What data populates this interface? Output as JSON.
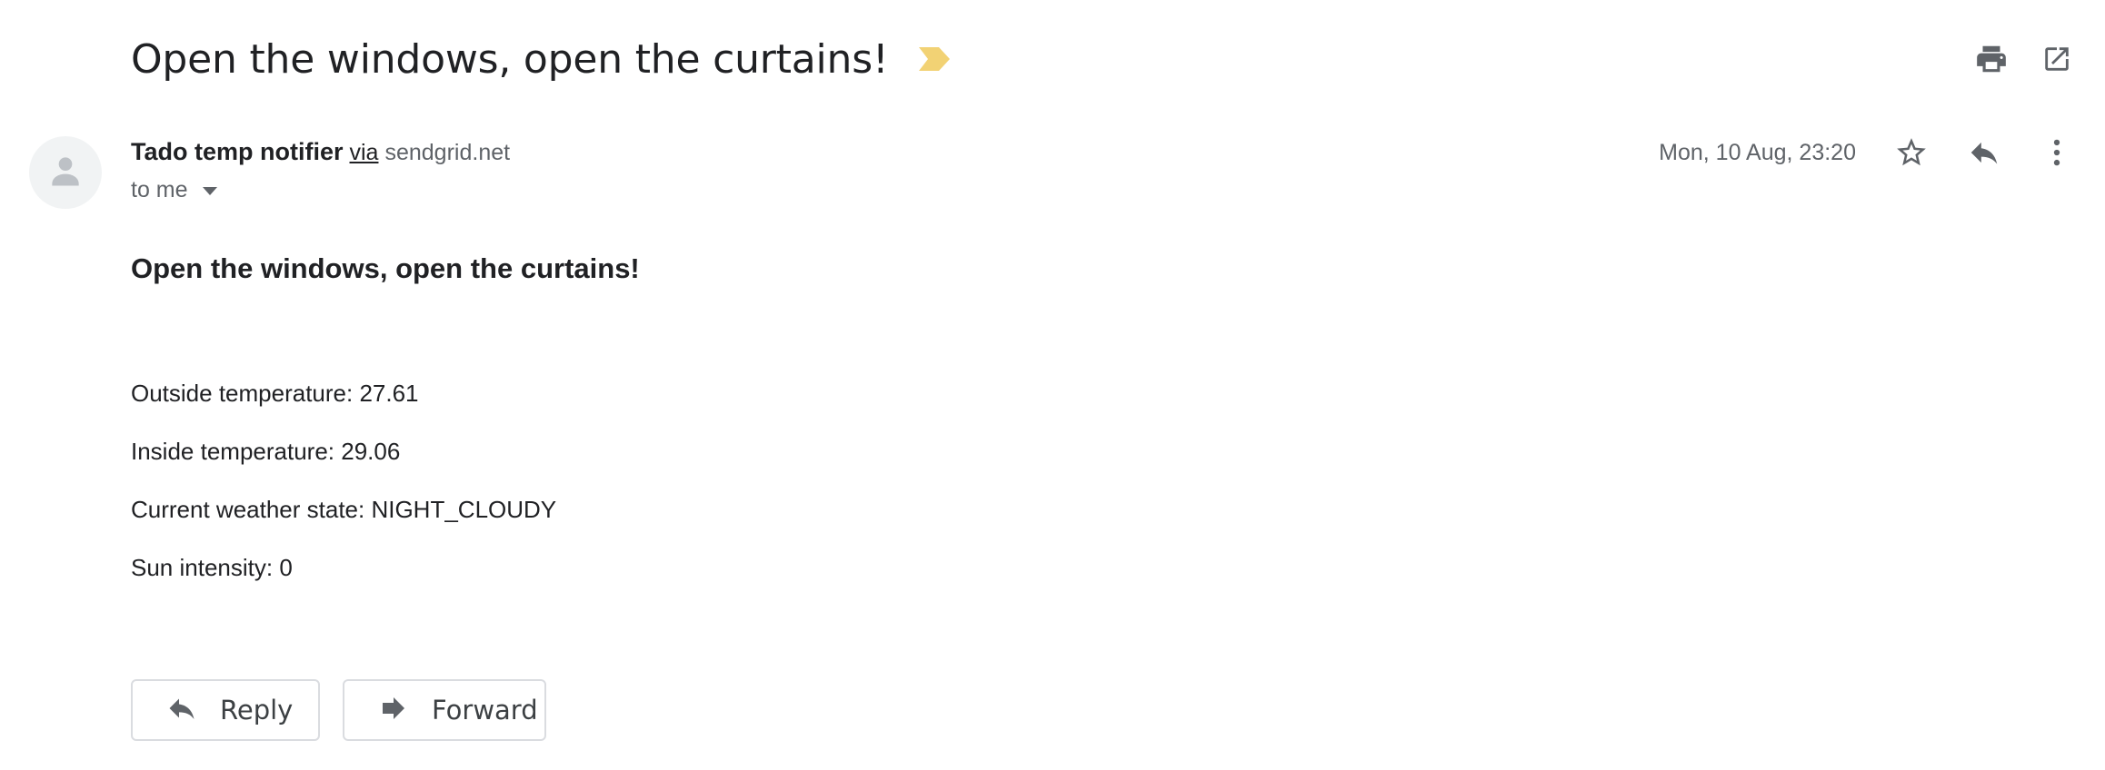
{
  "subject": {
    "title": "Open the windows, open the curtains!",
    "importance_icon": "importance-marker-icon",
    "importance_color": "#f2d274"
  },
  "toolbar": {
    "print_icon": "print-icon",
    "open_new_window_icon": "open-in-new-icon"
  },
  "message": {
    "sender_name": "Tado temp notifier",
    "via_label": "via",
    "via_domain": "sendgrid.net",
    "recipient": "to me",
    "timestamp": "Mon, 10 Aug, 23:20",
    "star_icon": "star-icon",
    "reply_icon": "reply-icon",
    "more_icon": "more-vert-icon"
  },
  "body": {
    "heading": "Open the windows, open the curtains!",
    "lines": [
      "Outside temperature: 27.61",
      "Inside temperature: 29.06",
      "Current weather state: NIGHT_CLOUDY",
      "Sun intensity: 0"
    ]
  },
  "actions": {
    "reply_label": "Reply",
    "forward_label": "Forward"
  },
  "colors": {
    "text_primary": "#202124",
    "text_secondary": "#5f6368",
    "icon_gray": "#5f6368",
    "border": "#dadce0"
  }
}
